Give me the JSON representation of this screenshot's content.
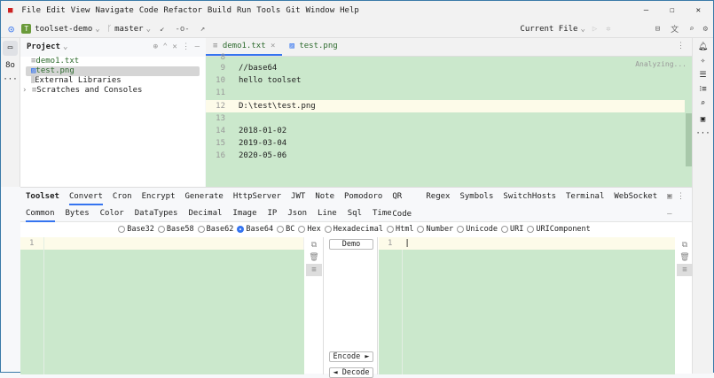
{
  "menu": [
    "File",
    "Edit",
    "View",
    "Navigate",
    "Code",
    "Refactor",
    "Build",
    "Run",
    "Tools",
    "Git",
    "Window",
    "Help"
  ],
  "toolbar": {
    "project": "toolset-demo",
    "project_badge": "T",
    "branch": "master",
    "run_config": "Current File"
  },
  "project_panel": {
    "title": "Project",
    "items": [
      {
        "label": "demo1.txt",
        "icon": "text-file-icon"
      },
      {
        "label": "test.png",
        "icon": "image-file-icon",
        "selected": true
      },
      {
        "label": "External Libraries",
        "icon": "library-icon"
      },
      {
        "label": "Scratches and Consoles",
        "icon": "scratch-icon"
      }
    ]
  },
  "editor": {
    "tabs": [
      "demo1.txt",
      "test.png"
    ],
    "status": "Analyzing...",
    "lines": [
      {
        "n": "9",
        "t": "//base64"
      },
      {
        "n": "10",
        "t": "hello toolset"
      },
      {
        "n": "11",
        "t": ""
      },
      {
        "n": "12",
        "t": "D:\\test\\test.png"
      },
      {
        "n": "13",
        "t": ""
      },
      {
        "n": "14",
        "t": "2018-01-02"
      },
      {
        "n": "15",
        "t": "2019-03-04"
      },
      {
        "n": "16",
        "t": "2020-05-06"
      }
    ]
  },
  "toolset": {
    "tabs": [
      "Toolset",
      "Convert",
      "Cron",
      "Encrypt",
      "Generate",
      "HttpServer",
      "JWT",
      "Note",
      "Pomodoro",
      "QR Code",
      "Regex",
      "Symbols",
      "SwitchHosts",
      "Terminal",
      "WebSocket"
    ],
    "subtabs": [
      "Common",
      "Bytes",
      "Color",
      "DataTypes",
      "Decimal",
      "Image",
      "IP",
      "Json",
      "Line",
      "Sql",
      "Time"
    ],
    "radios": [
      "Base32",
      "Base58",
      "Base62",
      "Base64",
      "BC",
      "Hex",
      "Hexadecimal",
      "Html",
      "Number",
      "Unicode",
      "URI",
      "URIComponent"
    ],
    "selected_radio": "Base64",
    "demo": "Demo",
    "encode": "Encode ►",
    "decode": "◄ Decode",
    "left_line": "1",
    "right_line": "1"
  }
}
